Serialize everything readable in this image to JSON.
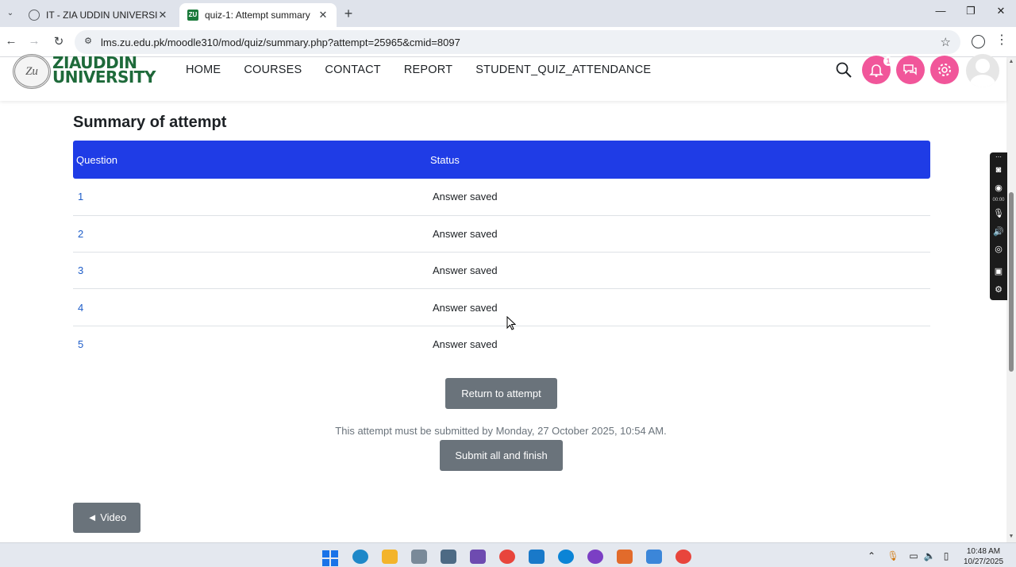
{
  "browser": {
    "tabs": [
      {
        "title": "IT - ZIA UDDIN UNIVERSITY",
        "active": false
      },
      {
        "title": "quiz-1: Attempt summary",
        "active": true
      }
    ],
    "active_favicon_text": "ZU",
    "url": "lms.zu.edu.pk/moodle310/mod/quiz/summary.php?attempt=25965&cmid=8097"
  },
  "site": {
    "logo_text_line1": "ZIAUDDIN",
    "logo_text_line2": "UNIVERSITY",
    "logo_seal_text": "Zu",
    "menu": [
      "HOME",
      "COURSES",
      "CONTACT",
      "REPORT",
      "STUDENT_QUIZ_ATTENDANCE"
    ],
    "notification_count": "1",
    "accent_color": "#f1569a"
  },
  "page": {
    "heading": "Summary of attempt",
    "table": {
      "headers": [
        "Question",
        "Status"
      ],
      "rows": [
        {
          "question": "1",
          "status": "Answer saved"
        },
        {
          "question": "2",
          "status": "Answer saved"
        },
        {
          "question": "3",
          "status": "Answer saved"
        },
        {
          "question": "4",
          "status": "Answer saved"
        },
        {
          "question": "5",
          "status": "Answer saved"
        }
      ],
      "header_color": "#1f3ce6"
    },
    "return_button": "Return to attempt",
    "deadline_notice": "This attempt must be submitted by Monday, 27 October 2025, 10:54 AM.",
    "submit_button": "Submit all and finish",
    "prev_button": "◄ Video"
  },
  "recorder": {
    "timer": "00:00"
  },
  "taskbar": {
    "time": "10:48 AM",
    "date": "10/27/2025"
  }
}
